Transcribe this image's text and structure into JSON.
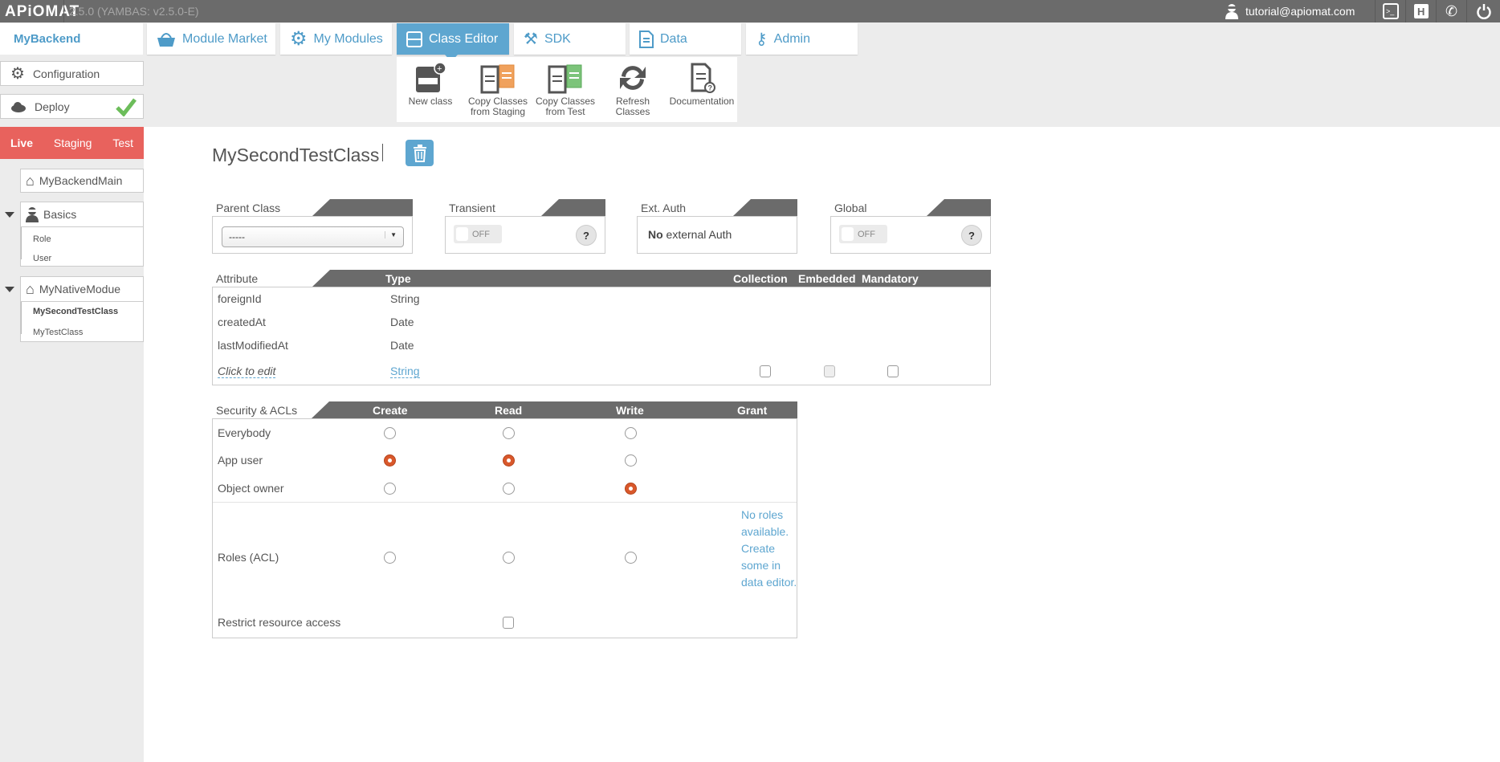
{
  "topbar": {
    "logo": "APiOMAT",
    "version": "2.5.0 (YAMBAS: v2.5.0-E)",
    "user_email": "tutorial@apiomat.com",
    "icons": [
      "terminal-icon",
      "help-h-icon",
      "phone-icon",
      "power-icon"
    ]
  },
  "nav": {
    "brand": "MyBackend",
    "tabs": [
      {
        "label": "Module Market",
        "icon": "basket-icon"
      },
      {
        "label": "My Modules",
        "icon": "gear-icon"
      },
      {
        "label": "Class Editor",
        "icon": "class-icon",
        "active": true
      },
      {
        "label": "SDK",
        "icon": "tools-icon"
      },
      {
        "label": "Data",
        "icon": "document-icon"
      },
      {
        "label": "Admin",
        "icon": "key-icon"
      }
    ]
  },
  "submenu": [
    {
      "label": "New class"
    },
    {
      "label": "Copy Classes from Staging"
    },
    {
      "label": "Copy Classes from Test"
    },
    {
      "label": "Refresh Classes"
    },
    {
      "label": "Documentation"
    }
  ],
  "sidebar": {
    "configuration": "Configuration",
    "deploy": "Deploy",
    "envs": [
      "Live",
      "Staging",
      "Test"
    ],
    "active_env": "Live",
    "main_module": "MyBackendMain",
    "groups": [
      {
        "name": "Basics",
        "items": [
          "Role",
          "User"
        ]
      },
      {
        "name": "MyNativeModue",
        "items": [
          "MySecondTestClass",
          "MyTestClass"
        ],
        "selected": "MySecondTestClass"
      }
    ]
  },
  "main": {
    "title": "MySecondTestClass",
    "props": {
      "parent_label": "Parent Class",
      "parent_value": "-----",
      "transient_label": "Transient",
      "transient_value": "OFF",
      "extauth_label": "Ext. Auth",
      "extauth_bold": "No",
      "extauth_rest": " external Auth",
      "global_label": "Global",
      "global_value": "OFF",
      "help": "?"
    },
    "attributes": {
      "headers": [
        "Attribute",
        "Type",
        "Collection",
        "Embedded",
        "Mandatory"
      ],
      "rows": [
        {
          "name": "foreignId",
          "type": "String"
        },
        {
          "name": "createdAt",
          "type": "Date"
        },
        {
          "name": "lastModifiedAt",
          "type": "Date"
        }
      ],
      "new_row": {
        "name": "Click to edit",
        "type": "String",
        "collection": false,
        "embedded": false,
        "mandatory": false
      }
    },
    "security": {
      "headers": [
        "Security & ACLs",
        "Create",
        "Read",
        "Write",
        "Grant"
      ],
      "rows": [
        {
          "label": "Everybody",
          "create": false,
          "read": false,
          "write": false
        },
        {
          "label": "App user",
          "create": true,
          "read": true,
          "write": false
        },
        {
          "label": "Object owner",
          "create": false,
          "read": false,
          "write": true
        },
        {
          "label": "Roles (ACL)",
          "create": false,
          "read": false,
          "write": false
        }
      ],
      "roles_note": "No roles available. Create some in data editor.",
      "restrict_label": "Restrict resource access",
      "restrict": false
    }
  },
  "colors": {
    "accent": "#5ea6d0",
    "live": "#e8625d",
    "radio_on": "#d9582b",
    "header": "#6b6b6b"
  }
}
